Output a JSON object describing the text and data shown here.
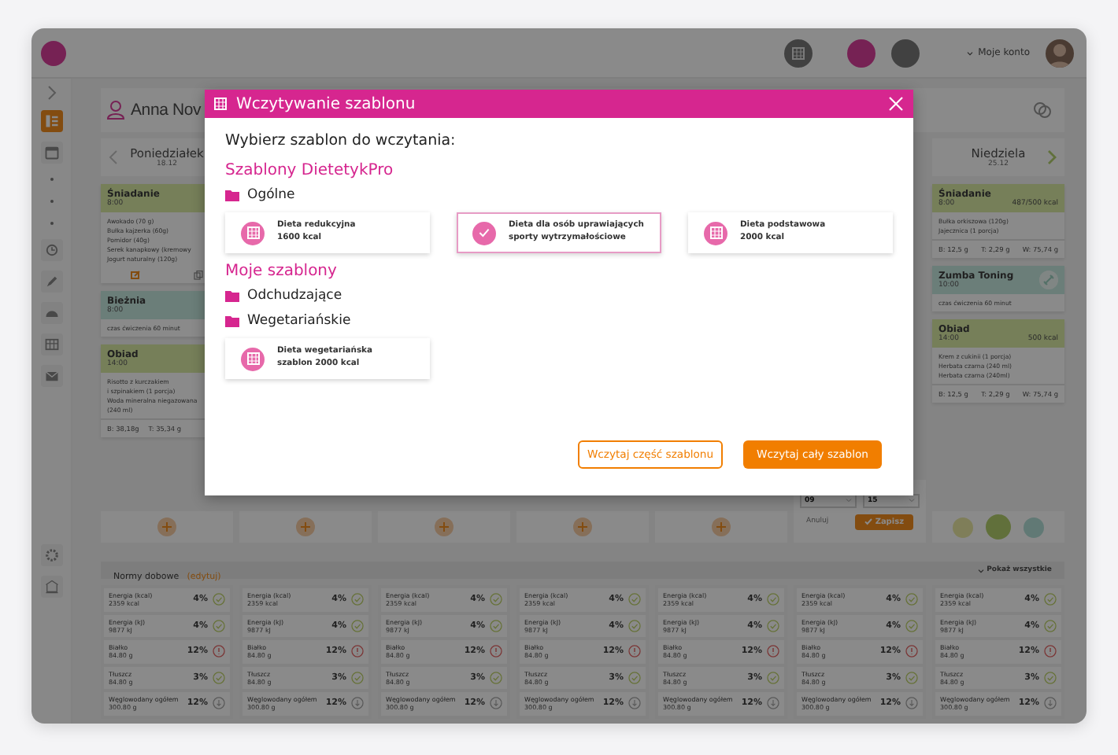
{
  "topbar": {
    "account": "Moje konto"
  },
  "sidebar": {
    "items": [
      {
        "selected": true
      },
      {
        "selected": false
      },
      {
        "selected": false
      },
      {
        "selected": false
      },
      {
        "selected": false
      },
      {
        "selected": false
      },
      {
        "selected": false
      }
    ]
  },
  "patient": {
    "name": "Anna Nov"
  },
  "days": [
    {
      "name": "Poniedziałek",
      "date": "18.12",
      "meals": [
        {
          "kind": "meal",
          "title": "Śniadanie",
          "time": "8:00",
          "tools": true,
          "items": [
            "Awokado (70 g)",
            "Bułka kajzerka (60g)",
            "Pomidor (40g)",
            "Serek kanapkowy (kremowy",
            "Jogurt naturalny (120g)"
          ]
        },
        {
          "kind": "activity",
          "title": "Bieżnia",
          "time": "8:00",
          "items": [
            "czas ćwiczenia 60 minut"
          ]
        },
        {
          "kind": "meal",
          "title": "Obiad",
          "time": "14:00",
          "items": [
            "Risotto z kurczakiem",
            "i szpinakiem (1 porcja)",
            "Woda mineralna niegazowana",
            "(240 ml)"
          ],
          "macros": [
            "B: 38,18g",
            "T: 35,34 g"
          ]
        }
      ],
      "footer": {
        "kind": "add"
      }
    },
    {
      "footer": {
        "kind": "add"
      }
    },
    {
      "footer": {
        "kind": "add"
      }
    },
    {
      "footer": {
        "kind": "add"
      }
    },
    {
      "footer": {
        "kind": "add"
      }
    },
    {
      "footer": {
        "kind": "time_picker",
        "hour": "09",
        "minute": "15",
        "cancel": "Anuluj",
        "save": "Zapisz"
      }
    },
    {
      "name": "Niedziela",
      "date": "25.12",
      "meals": [
        {
          "kind": "meal",
          "title": "Śniadanie",
          "time": "8:00",
          "kcal": "487/500 kcal",
          "items": [
            "Bułka orkiszowa (120g)",
            "Jajecznica (1 porcja)"
          ],
          "macros": [
            "B: 12,5 g",
            "T: 2,29 g",
            "W: 75,74 g"
          ]
        },
        {
          "kind": "activity",
          "title": "Zumba Toning",
          "time": "10:00",
          "badge": true,
          "items": [
            "czas ćwiczenia 60 minut"
          ]
        },
        {
          "kind": "meal",
          "title": "Obiad",
          "time": "14:00",
          "kcal": "500 kcal",
          "items": [
            "Krem z cukinii (1 porcja)",
            "Herbata czarna (240 ml)",
            "Herbata czarna (240ml)"
          ],
          "macros": [
            "B: 12,5 g",
            "T: 2,29 g",
            "W: 75,74 g"
          ]
        }
      ],
      "footer": {
        "kind": "actions"
      }
    }
  ],
  "norms": {
    "title": "Normy dobowe",
    "edit_link": "(edytuj)",
    "toggle": "Pokaż wszystkie",
    "columns": [
      [
        {
          "label": "Energia (kcal)",
          "value": "2359 kcal",
          "percent": "4%",
          "kind": "ok"
        },
        {
          "label": "Energia (kJ)",
          "value": "9877 kJ",
          "percent": "4%",
          "kind": "ok"
        },
        {
          "label": "Białko",
          "value": "84.80 g",
          "percent": "12%",
          "kind": "alert"
        },
        {
          "label": "Tłuszcz",
          "value": "84.80 g",
          "percent": "3%",
          "kind": "ok"
        },
        {
          "label": "Węglowodany ogółem",
          "value": "300.80 g",
          "percent": "12%",
          "kind": "info"
        }
      ],
      [
        {
          "label": "Energia (kcal)",
          "value": "2359 kcal",
          "percent": "4%",
          "kind": "ok"
        },
        {
          "label": "Energia (kJ)",
          "value": "9877 kJ",
          "percent": "4%",
          "kind": "ok"
        },
        {
          "label": "Białko",
          "value": "84.80 g",
          "percent": "12%",
          "kind": "alert"
        },
        {
          "label": "Tłuszcz",
          "value": "84.80 g",
          "percent": "3%",
          "kind": "ok"
        },
        {
          "label": "Węglowodany ogółem",
          "value": "300.80 g",
          "percent": "12%",
          "kind": "info"
        }
      ],
      [
        {
          "label": "Energia (kcal)",
          "value": "2359 kcal",
          "percent": "4%",
          "kind": "ok"
        },
        {
          "label": "Energia (kJ)",
          "value": "9877 kJ",
          "percent": "4%",
          "kind": "ok"
        },
        {
          "label": "Białko",
          "value": "84.80 g",
          "percent": "12%",
          "kind": "alert"
        },
        {
          "label": "Tłuszcz",
          "value": "84.80 g",
          "percent": "3%",
          "kind": "ok"
        },
        {
          "label": "Węglowodany ogółem",
          "value": "300.80 g",
          "percent": "12%",
          "kind": "info"
        }
      ],
      [
        {
          "label": "Energia (kcal)",
          "value": "2359 kcal",
          "percent": "4%",
          "kind": "ok"
        },
        {
          "label": "Energia (kJ)",
          "value": "9877 kJ",
          "percent": "4%",
          "kind": "ok"
        },
        {
          "label": "Białko",
          "value": "84.80 g",
          "percent": "12%",
          "kind": "alert"
        },
        {
          "label": "Tłuszcz",
          "value": "84.80 g",
          "percent": "3%",
          "kind": "ok"
        },
        {
          "label": "Węglowodany ogółem",
          "value": "300.80 g",
          "percent": "12%",
          "kind": "info"
        }
      ],
      [
        {
          "label": "Energia (kcal)",
          "value": "2359 kcal",
          "percent": "4%",
          "kind": "ok"
        },
        {
          "label": "Energia (kJ)",
          "value": "9877 kJ",
          "percent": "4%",
          "kind": "ok"
        },
        {
          "label": "Białko",
          "value": "84.80 g",
          "percent": "12%",
          "kind": "alert"
        },
        {
          "label": "Tłuszcz",
          "value": "84.80 g",
          "percent": "3%",
          "kind": "ok"
        },
        {
          "label": "Węglowodany ogółem",
          "value": "300.80 g",
          "percent": "12%",
          "kind": "info"
        }
      ],
      [
        {
          "label": "Energia (kcal)",
          "value": "2359 kcal",
          "percent": "4%",
          "kind": "ok"
        },
        {
          "label": "Energia (kJ)",
          "value": "9877 kJ",
          "percent": "4%",
          "kind": "ok"
        },
        {
          "label": "Białko",
          "value": "84.80 g",
          "percent": "12%",
          "kind": "alert"
        },
        {
          "label": "Tłuszcz",
          "value": "84.80 g",
          "percent": "3%",
          "kind": "ok"
        },
        {
          "label": "Węglowodany ogółem",
          "value": "300.80 g",
          "percent": "12%",
          "kind": "info"
        }
      ],
      [
        {
          "label": "Energia (kcal)",
          "value": "2359 kcal",
          "percent": "4%",
          "kind": "ok"
        },
        {
          "label": "Energia (kJ)",
          "value": "9877 kJ",
          "percent": "4%",
          "kind": "ok"
        },
        {
          "label": "Białko",
          "value": "84.80 g",
          "percent": "12%",
          "kind": "alert"
        },
        {
          "label": "Tłuszcz",
          "value": "84.80 g",
          "percent": "3%",
          "kind": "ok"
        },
        {
          "label": "Węglowodany ogółem",
          "value": "300.80 g",
          "percent": "12%",
          "kind": "info"
        }
      ]
    ]
  },
  "modal": {
    "title": "Wczytywanie szablonu",
    "prompt": "Wybierz szablon do wczytania:",
    "sections": [
      {
        "heading": "Szablony DietetykPro",
        "folders": [
          {
            "name": "Ogólne",
            "templates": [
              {
                "lines": [
                  "Dieta redukcyjna",
                  "1600 kcal"
                ],
                "selected": false
              },
              {
                "lines": [
                  "Dieta dla osób uprawiających",
                  "sporty wytrzymałościowe"
                ],
                "selected": true
              },
              {
                "lines": [
                  "Dieta podstawowa",
                  "2000 kcal"
                ],
                "selected": false
              }
            ]
          }
        ]
      },
      {
        "heading": "Moje szablony",
        "folders": [
          {
            "name": "Odchudzające"
          },
          {
            "name": "Wegetariańskie",
            "templates": [
              {
                "lines": [
                  "Dieta wegetariańska",
                  "szablon 2000 kcal"
                ],
                "selected": false
              }
            ]
          }
        ]
      }
    ],
    "buttons": [
      {
        "label": "Wczytaj część szablonu",
        "kind": "outline"
      },
      {
        "label": "Wczytaj cały szablon",
        "kind": "filled"
      }
    ]
  }
}
